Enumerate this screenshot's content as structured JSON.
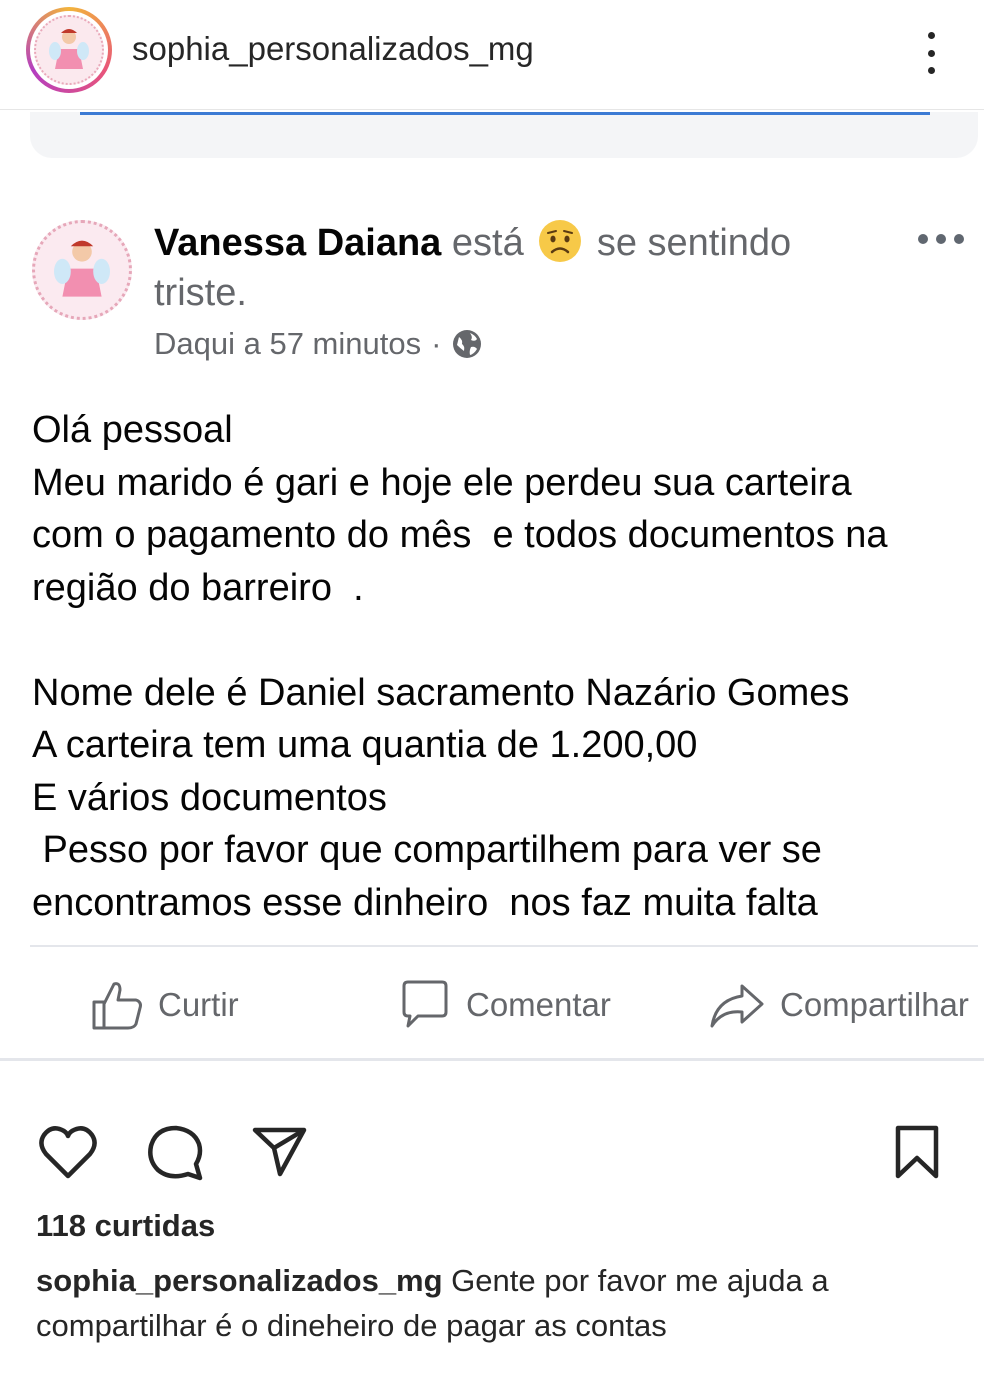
{
  "instagram": {
    "username": "sophia_personalizados_mg",
    "likes": "118 curtidas",
    "caption_user": "sophia_personalizados_mg",
    "caption_text": " Gente por favor me ajuda a compartilhar  é o dineheiro de pagar as contas",
    "icons": [
      "heart-icon",
      "comment-icon",
      "share-icon",
      "bookmark-icon",
      "more-vertical-icon"
    ]
  },
  "facebook_post": {
    "author": "Vanessa Daiana",
    "feeling_prefix": "está",
    "feeling_emoji": "sad-face-emoji",
    "feeling_text": "se sentindo triste.",
    "timestamp": "Daqui a 57 minutos",
    "meta_separator": "·",
    "privacy_icon": "globe-icon",
    "body_lines": [
      "Olá pessoal",
      "Meu marido é gari e hoje ele perdeu sua carteira",
      "com o pagamento do mês  e todos documentos na",
      "região do barreiro  .",
      "",
      "Nome dele é Daniel sacramento Nazário Gomes",
      "A carteira tem uma quantia de 1.200,00",
      "E vários documentos",
      " Pesso por favor que compartilhem para ver se",
      "encontramos esse dinheiro  nos faz muita falta"
    ],
    "actions": {
      "like": "Curtir",
      "comment": "Comentar",
      "share": "Compartilhar"
    }
  },
  "colors": {
    "text_dark": "#262626",
    "fb_text": "#050505",
    "fb_muted": "#65676b",
    "emoji_yellow": "#f7c948",
    "accent_line": "#3c7bd4"
  }
}
